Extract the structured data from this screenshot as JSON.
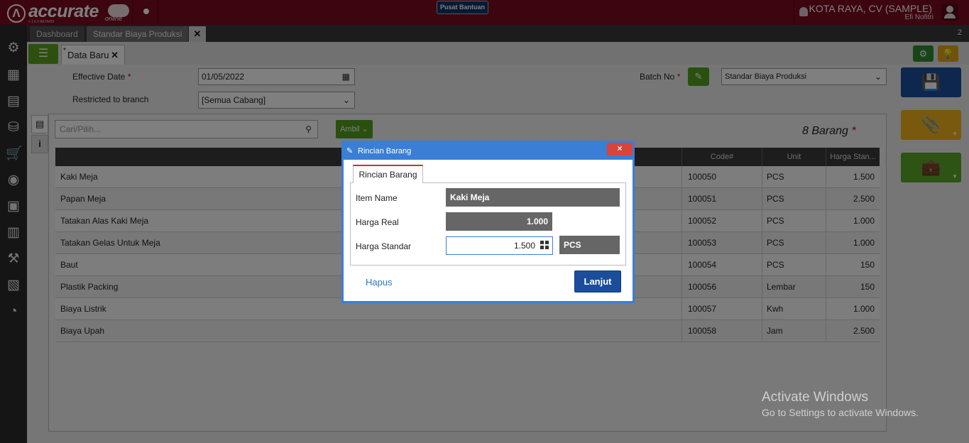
{
  "app": {
    "logo_text": "accurate",
    "logo_sub": "online",
    "logo_version": "v 1.0.0 BETA/09",
    "help_label": "Pusat Bantuan",
    "company": "KOTA RAYA, CV (SAMPLE)",
    "user": "Efi Nofitri"
  },
  "tabs": [
    {
      "label": "Dashboard"
    },
    {
      "label": "Standar Biaya Produksi"
    }
  ],
  "tab_count": "2",
  "doc_tab": {
    "label": "Data Baru",
    "star": "*"
  },
  "form": {
    "effective_date_label": "Effective Date",
    "effective_date_value": "01/05/2022",
    "restricted_label": "Restricted to branch",
    "restricted_value": "[Semua Cabang]",
    "batch_label": "Batch No",
    "batch_value": "Standar Biaya Produksi",
    "required_mark": "*"
  },
  "search": {
    "placeholder": "Cari/Pilih...",
    "ambil_label": "Ambil"
  },
  "item_count": "8 Barang",
  "table": {
    "headers": {
      "code": "Code#",
      "unit": "Unit",
      "price": "Harga Stan..."
    },
    "rows": [
      {
        "name": "Kaki Meja",
        "code": "100050",
        "unit": "PCS",
        "price": "1.500"
      },
      {
        "name": "Papan Meja",
        "code": "100051",
        "unit": "PCS",
        "price": "2.500"
      },
      {
        "name": "Tatakan Alas Kaki Meja",
        "code": "100052",
        "unit": "PCS",
        "price": "1.000"
      },
      {
        "name": "Tatakan Gelas Untuk Meja",
        "code": "100053",
        "unit": "PCS",
        "price": "1.000"
      },
      {
        "name": "Baut",
        "code": "100054",
        "unit": "PCS",
        "price": "150"
      },
      {
        "name": "Plastik Packing",
        "code": "100056",
        "unit": "Lembar",
        "price": "150"
      },
      {
        "name": "Biaya Listrik",
        "code": "100057",
        "unit": "Kwh",
        "price": "1.000"
      },
      {
        "name": "Biaya Upah",
        "code": "100058",
        "unit": "Jam",
        "price": "2.500"
      }
    ]
  },
  "dialog": {
    "title": "Rincian Barang",
    "tab_label": "Rincian Barang",
    "item_name_label": "Item Name",
    "item_name_value": "Kaki Meja",
    "harga_real_label": "Harga Real",
    "harga_real_value": "1.000",
    "harga_standar_label": "Harga Standar",
    "harga_standar_value": "1.500",
    "unit_value": "PCS",
    "hapus_label": "Hapus",
    "lanjut_label": "Lanjut",
    "close_label": "×"
  },
  "watermark": {
    "line1": "Activate Windows",
    "line2": "Go to Settings to activate Windows."
  },
  "colors": {
    "topbar": "#7a0a1e",
    "accent_green": "#55a020",
    "accent_blue": "#1a4e9c",
    "dialog_border": "#3a7fd5"
  }
}
